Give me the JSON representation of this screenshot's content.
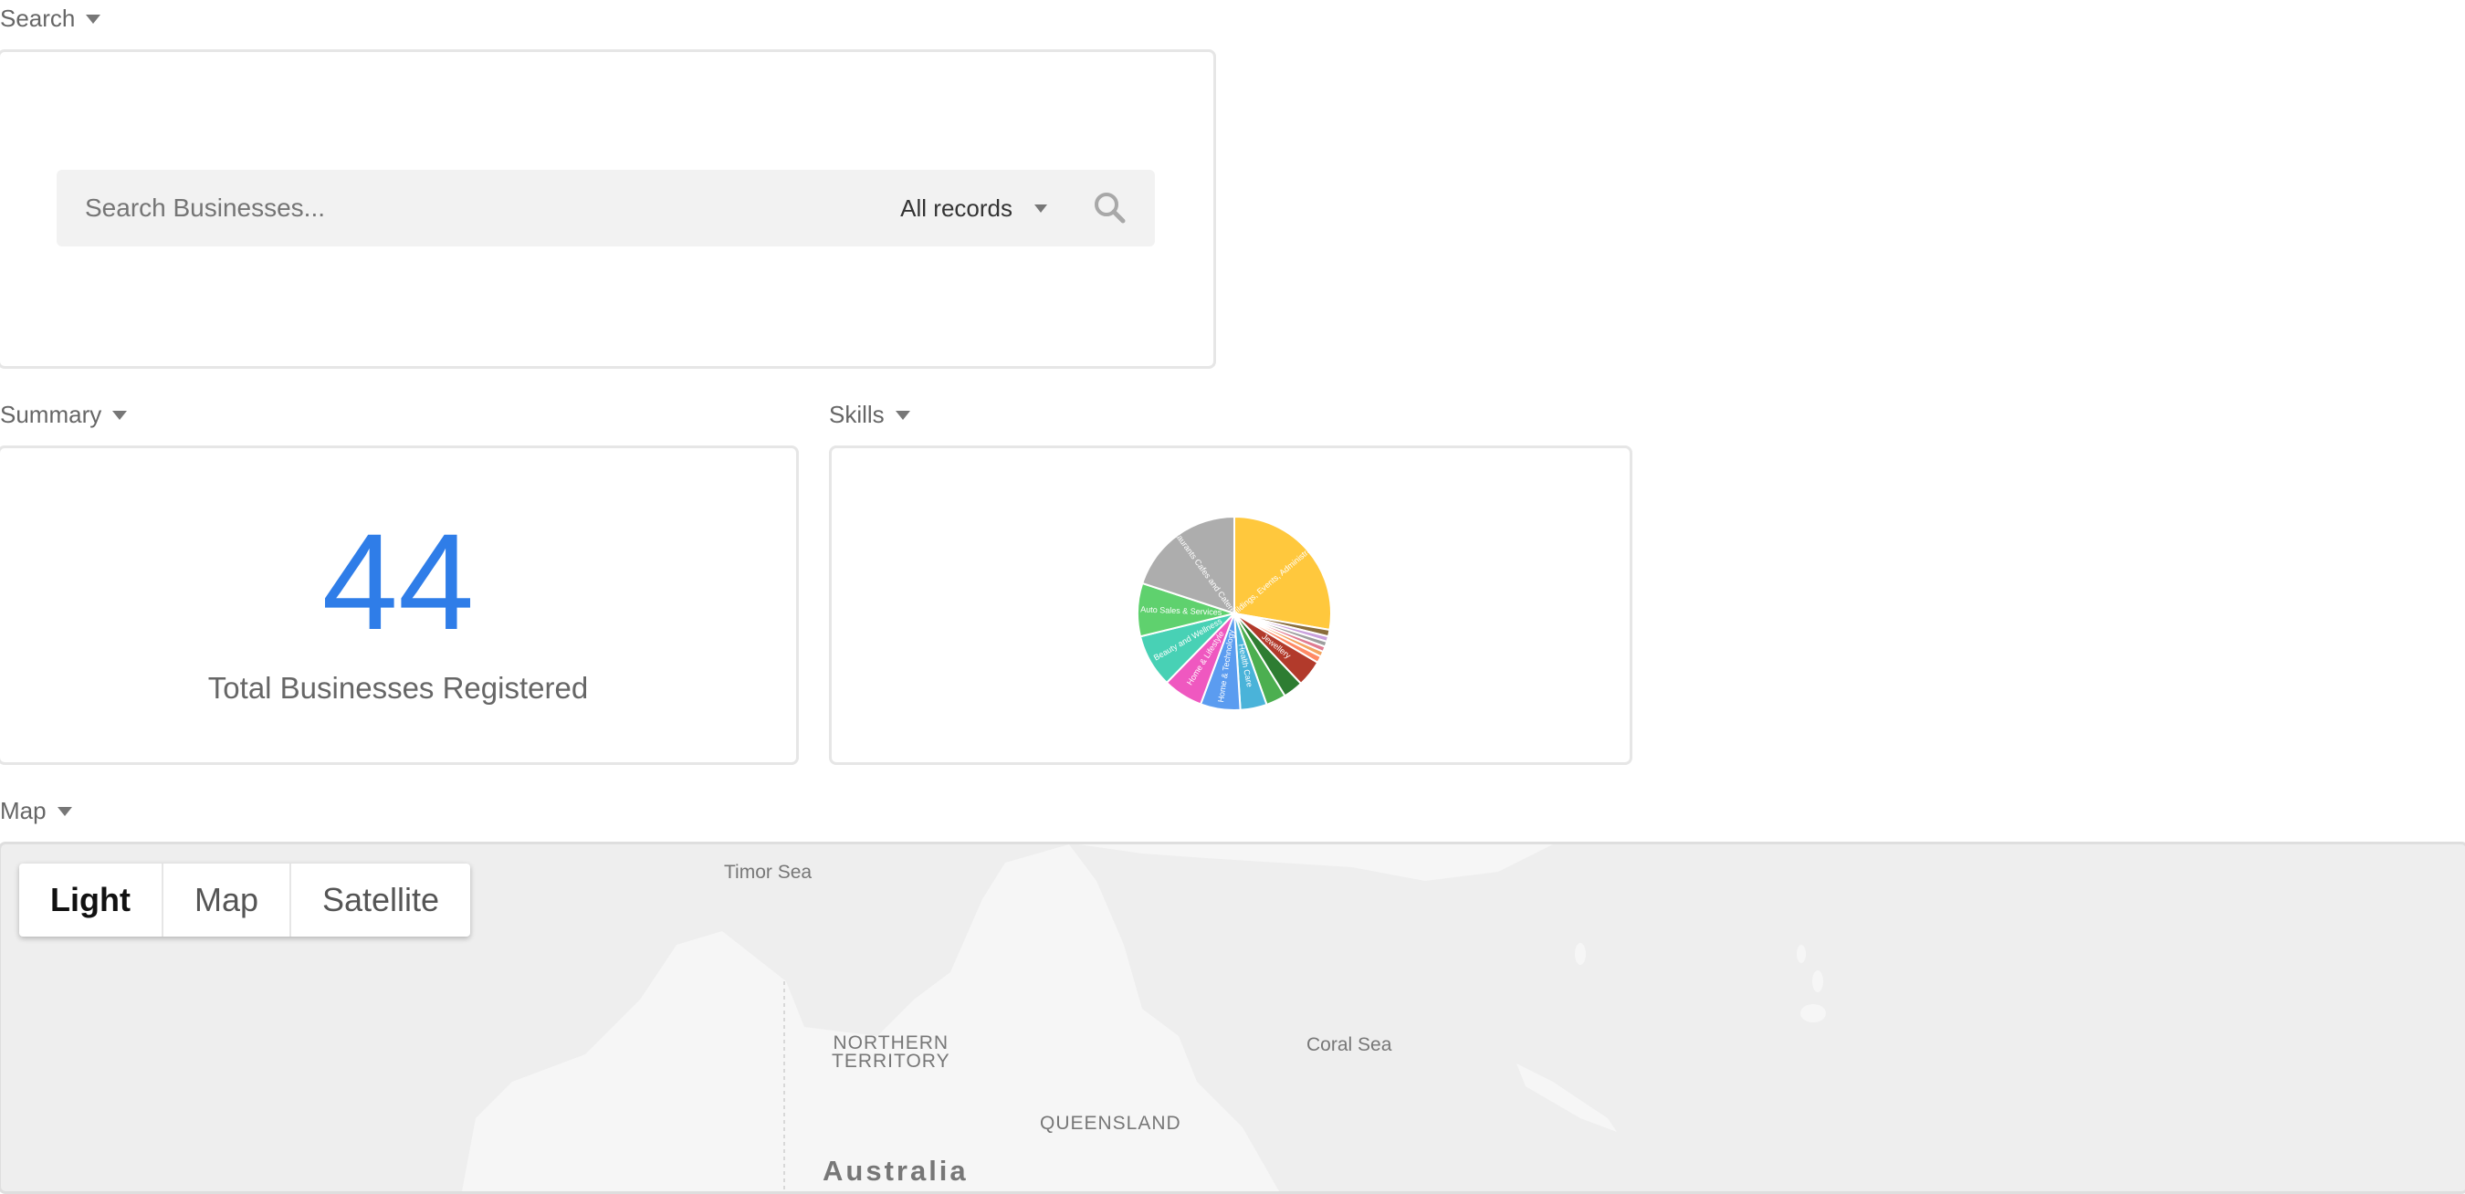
{
  "sections": {
    "search": "Search",
    "summary": "Summary",
    "skills": "Skills",
    "map": "Map"
  },
  "search": {
    "placeholder": "Search Businesses...",
    "scope": "All records",
    "icon": "search-icon"
  },
  "summary": {
    "count": "44",
    "label": "Total Businesses Registered"
  },
  "chart_data": {
    "type": "pie",
    "series": [
      {
        "label": "Buildings, Events, Administration",
        "value": 25,
        "color": "#ffc83d"
      },
      {
        "label": "",
        "value": 1,
        "color": "#8a6d3b"
      },
      {
        "label": "",
        "value": 0.8,
        "color": "#c9a0dc"
      },
      {
        "label": "",
        "value": 0.8,
        "color": "#9e9e9e"
      },
      {
        "label": "",
        "value": 0.8,
        "color": "#e07b91"
      },
      {
        "label": "",
        "value": 0.8,
        "color": "#f4a460"
      },
      {
        "label": "",
        "value": 1,
        "color": "#ff8a65"
      },
      {
        "label": "Jewellery",
        "value": 4,
        "color": "#b23a2b"
      },
      {
        "label": "",
        "value": 3,
        "color": "#2e7d32"
      },
      {
        "label": "",
        "value": 3,
        "color": "#4caf50"
      },
      {
        "label": "Health Care",
        "value": 4,
        "color": "#4ab3d9"
      },
      {
        "label": "Home & Technology",
        "value": 6,
        "color": "#5b9cf0"
      },
      {
        "label": "Home & Lifestyle",
        "value": 6,
        "color": "#ef58c0"
      },
      {
        "label": "Beauty and Wellness",
        "value": 8,
        "color": "#48d1b5"
      },
      {
        "label": "Auto Sales & Services",
        "value": 8,
        "color": "#5fd16e"
      },
      {
        "label": "Restaurants Cafes and Caterers",
        "value": 18,
        "color": "#adadad"
      }
    ]
  },
  "map": {
    "buttons": [
      "Light",
      "Map",
      "Satellite"
    ],
    "active": "Light",
    "labels": {
      "timor_sea": "Timor Sea",
      "nt_line1": "NORTHERN",
      "nt_line2": "TERRITORY",
      "coral_sea": "Coral Sea",
      "queensland": "QUEENSLAND",
      "australia": "Australia"
    }
  }
}
